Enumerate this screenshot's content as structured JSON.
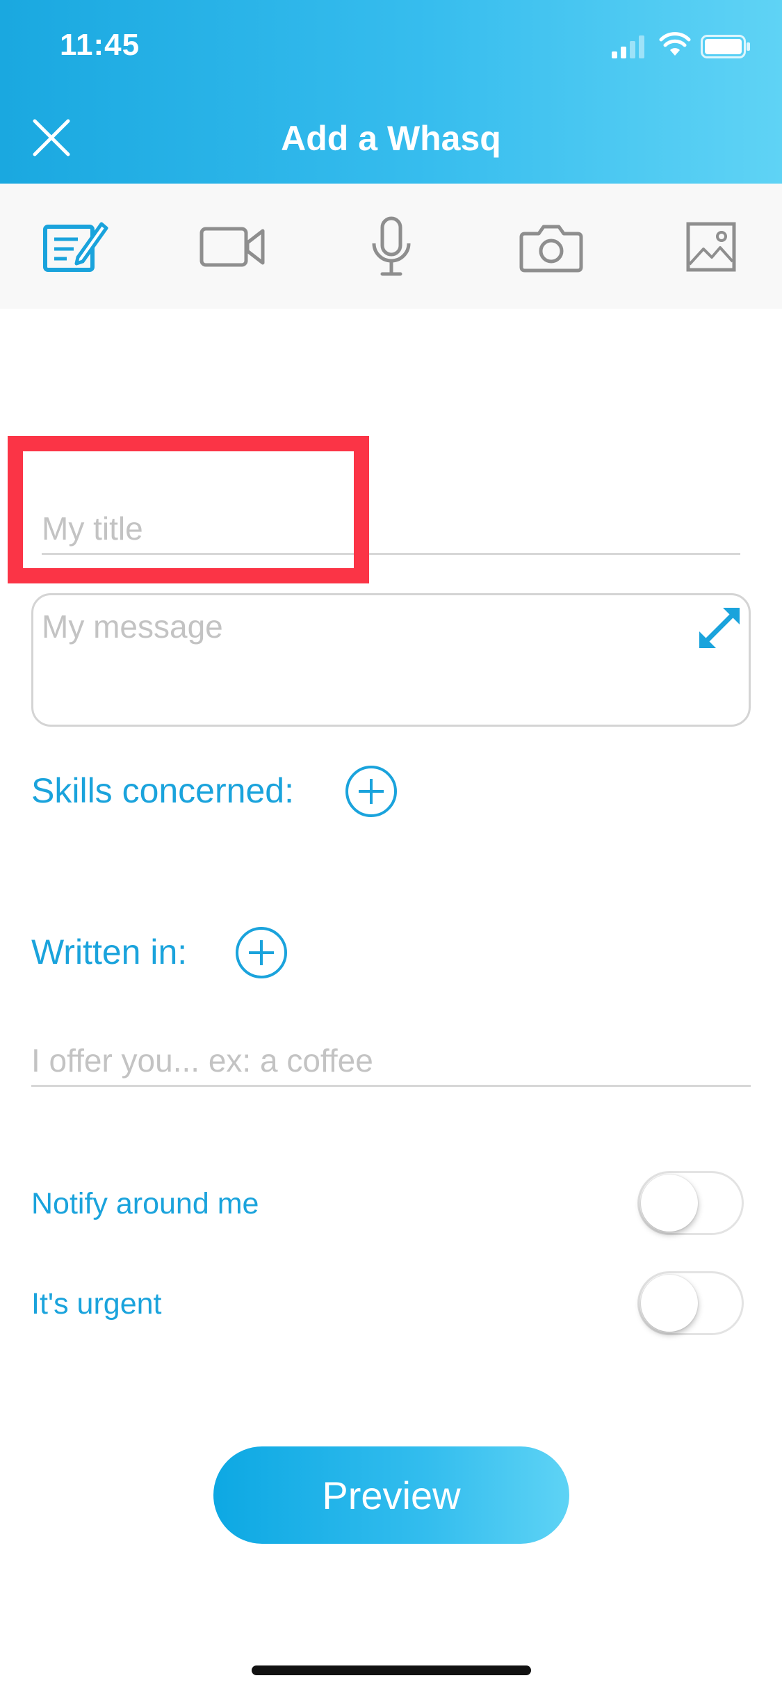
{
  "status_bar": {
    "time": "11:45"
  },
  "nav": {
    "title": "Add a Whasq"
  },
  "toolbar": {
    "items": [
      {
        "icon": "edit-text-icon",
        "active": true
      },
      {
        "icon": "video-camera-icon",
        "active": false
      },
      {
        "icon": "microphone-icon",
        "active": false
      },
      {
        "icon": "camera-icon",
        "active": false
      },
      {
        "icon": "image-icon",
        "active": false
      }
    ]
  },
  "form": {
    "title_placeholder": "My title",
    "title_value": "",
    "message_placeholder": "My message",
    "message_value": "",
    "skills_label": "Skills concerned:",
    "written_in_label": "Written in:",
    "offer_placeholder": "I offer you... ex: a coffee",
    "offer_value": "",
    "notify_label": "Notify around me",
    "notify_on": false,
    "urgent_label": "It's urgent",
    "urgent_on": false,
    "preview_label": "Preview"
  },
  "colors": {
    "accent": "#1aa3dc",
    "header_start": "#1aa8e0",
    "header_end": "#5fd3f5",
    "highlight": "#fb3446",
    "placeholder": "#c3c3c3",
    "icon_gray": "#8e8e8e"
  }
}
